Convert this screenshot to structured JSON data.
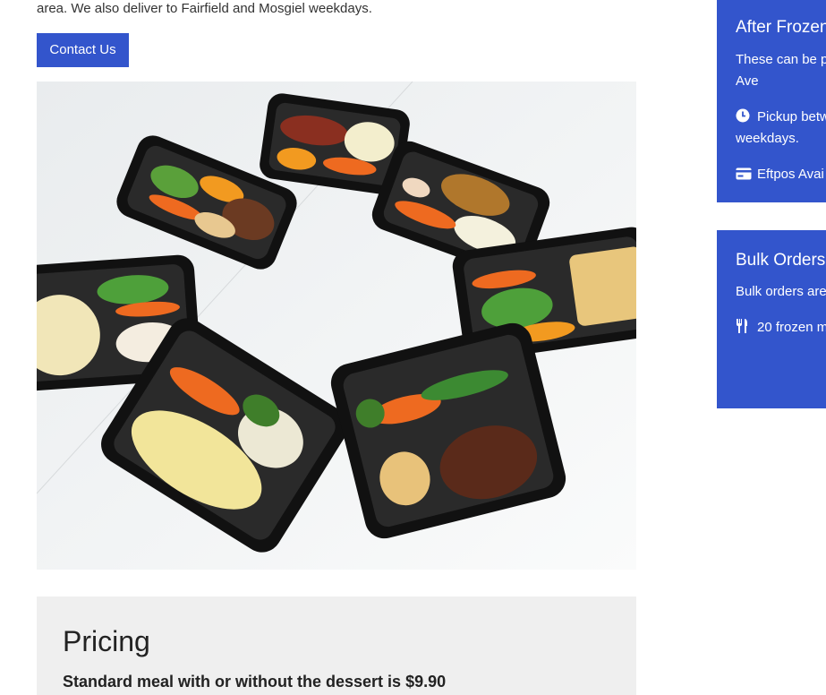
{
  "intro": {
    "text": "area. We also deliver to Fairfield and Mosgiel weekdays."
  },
  "contact_button": {
    "label": "Contact Us"
  },
  "meal_photo": {
    "subject": "eight black trays of frozen meals arranged in a circle"
  },
  "pricing": {
    "title": "Pricing",
    "standard_meal": "Standard meal with or without the dessert is $9.90"
  },
  "sidebar": {
    "after_frozen": {
      "title": "After Frozen",
      "line1": "These can be p",
      "line2": "Ave",
      "pickup_line1": "Pickup betw",
      "pickup_line2": "weekdays.",
      "eftpos": "Eftpos Avai"
    },
    "bulk_orders": {
      "title": "Bulk Orders",
      "line1": "Bulk orders are",
      "line2": "20 frozen m"
    }
  },
  "colors": {
    "accent": "#3355cc",
    "panel": "#efefef"
  }
}
